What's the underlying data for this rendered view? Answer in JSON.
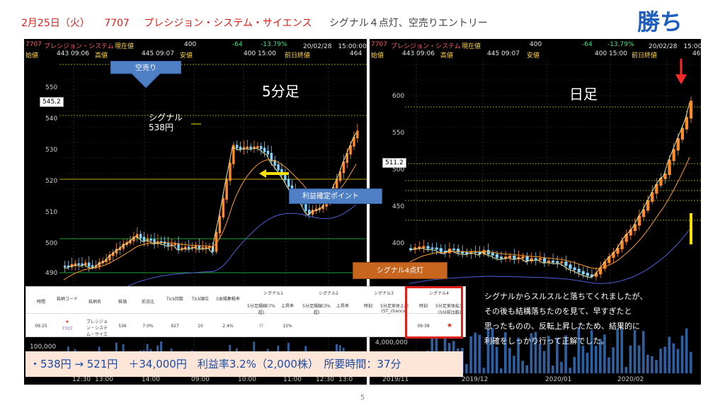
{
  "slide": {
    "title_date": "2月25日（火）",
    "title_code": "7707",
    "title_company": "プレシジョン・システム・サイエンス",
    "title_note": "シグナル４点灯、空売りエントリー",
    "win_label": "勝ち",
    "page_number": "5"
  },
  "header_left": {
    "row1": {
      "code": "7707",
      "name": "プレシジョン・システム",
      "label_now": "現在値",
      "now": "400",
      "chg": "-64",
      "pct": "-13.79%",
      "datetime": "20/02/28　15:00:00"
    },
    "row2": {
      "label_open": "始値",
      "open": "443 09:06",
      "label_high": "高値",
      "high": "445 09:07",
      "label_low": "安値",
      "low": "400 15:00",
      "label_prev": "前日終値",
      "prev": "464"
    }
  },
  "header_right": {
    "row1": {
      "code": "7707",
      "name": "プレシジョン・システム",
      "label_now": "現在値",
      "now": "400",
      "chg": "-64",
      "pct": "-13.79%",
      "datetime": "20/02/28　15:00:00"
    },
    "row2": {
      "label_open": "始値",
      "open": "443 09:06",
      "label_high": "高値",
      "high": "445 09:07",
      "label_low": "安値",
      "low": "400 15:00",
      "label_prev": "前日終値",
      "prev": "46"
    }
  },
  "left_chart": {
    "label": "5分足",
    "sell_label": "空売り",
    "signal_label": "シグナル",
    "signal_price": "538円",
    "profit_label": "利益確定ポイント",
    "price_box": "545.2",
    "y_ticks": [
      "550",
      "540",
      "530",
      "520",
      "510",
      "500",
      "490"
    ],
    "volume_tick": "100,000",
    "x_ticks": [
      "12:30",
      "13:00",
      "14:00",
      "09:00",
      "10:00",
      "11:00",
      "12:30",
      "13:0"
    ]
  },
  "right_chart": {
    "label": "日足",
    "price_box": "511.2",
    "y_ticks": [
      "600",
      "550",
      "500",
      "450",
      "400"
    ],
    "volume_tick": "4,000,000",
    "x_ticks": [
      "2019/11",
      "2019/12",
      "2020/01",
      "2020/02"
    ]
  },
  "signal4_callout": "シグナル4点灯",
  "table": {
    "headers": [
      "時間",
      "銘柄コード",
      "銘柄名",
      "株価",
      "前日比",
      "Tick回数",
      "Tick順位",
      "5本陽集積率"
    ],
    "groups": [
      "シグナル1",
      "シグナル2",
      "シグナル3",
      "シグナル4"
    ],
    "sub": [
      "5分足陽線(7%超)",
      "上昇率",
      "5分足陽線(3%超)",
      "上昇率",
      "時刻",
      "5分足実体上部(ST_chance)",
      "時刻",
      "5分足実体拡大(5分前比較)"
    ],
    "row": [
      "09:25",
      "7707",
      "プレシジョン・システム・サイエ",
      "536",
      "7.0%",
      "927",
      "10",
      "2.4%",
      "☆",
      "15%",
      "09:38",
      "★"
    ]
  },
  "comment": [
    "シグナルからスルスルと落ちてくれましたが、",
    "その後も結構落ちたのを見て、早すぎたと",
    "思ったものの、反転上昇したため、結果的に",
    "利確をしっかり行って正解でした。"
  ],
  "result": "・538円 → 521円　＋34,000円　利益率3.2%（2,000株）　所要時間：37分",
  "colors": {
    "accent_red": "#e0201b",
    "accent_blue": "#1f5fbf",
    "candle_up": "#ff8a2a",
    "candle_down": "#7fd3ff"
  }
}
